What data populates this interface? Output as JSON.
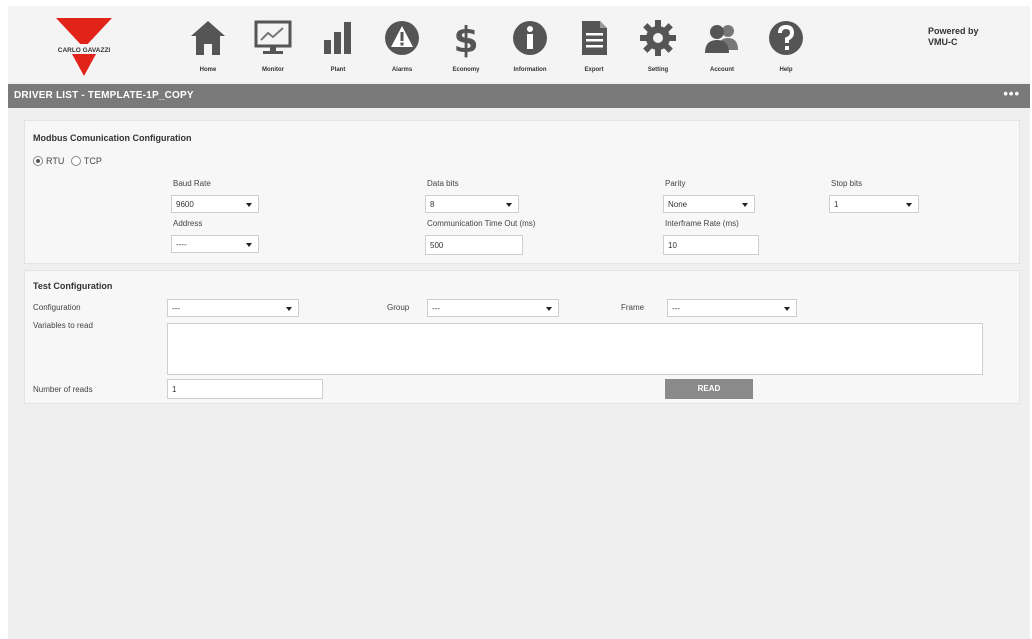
{
  "brand": {
    "name": "CARLO GAVAZZI",
    "color": "#e2231a"
  },
  "nav": [
    {
      "label": "Home",
      "icon": "home-icon"
    },
    {
      "label": "Monitor",
      "icon": "monitor-icon"
    },
    {
      "label": "Plant",
      "icon": "plant-icon"
    },
    {
      "label": "Alarms",
      "icon": "alarm-icon"
    },
    {
      "label": "Economy",
      "icon": "economy-icon"
    },
    {
      "label": "Information",
      "icon": "information-icon"
    },
    {
      "label": "Export",
      "icon": "export-icon"
    },
    {
      "label": "Setting",
      "icon": "gear-icon"
    },
    {
      "label": "Account",
      "icon": "account-icon"
    },
    {
      "label": "Help",
      "icon": "help-icon"
    }
  ],
  "powered": {
    "line1": "Powered by",
    "line2": "VMU-C"
  },
  "titlebar": {
    "title": "DRIVER LIST - TEMPLATE-1P_COPY",
    "menu": "•••"
  },
  "modbus": {
    "title": "Modbus Comunication Configuration",
    "rtu": "RTU",
    "tcp": "TCP",
    "baud_label": "Baud Rate",
    "baud_value": "9600",
    "databits_label": "Data bits",
    "databits_value": "8",
    "parity_label": "Parity",
    "parity_value": "None",
    "stopbits_label": "Stop bits",
    "stopbits_value": "1",
    "address_label": "Address",
    "address_value": "----",
    "timeout_label": "Communication Time Out (ms)",
    "timeout_value": "500",
    "interframe_label": "Interframe Rate (ms)",
    "interframe_value": "10"
  },
  "test": {
    "title": "Test Configuration",
    "configuration_label": "Configuration",
    "configuration_value": "---",
    "group_label": "Group",
    "group_value": "---",
    "frame_label": "Frame",
    "frame_value": "---",
    "variables_label": "Variables to read",
    "reads_label": "Number of reads",
    "reads_value": "1",
    "read_button": "READ"
  }
}
